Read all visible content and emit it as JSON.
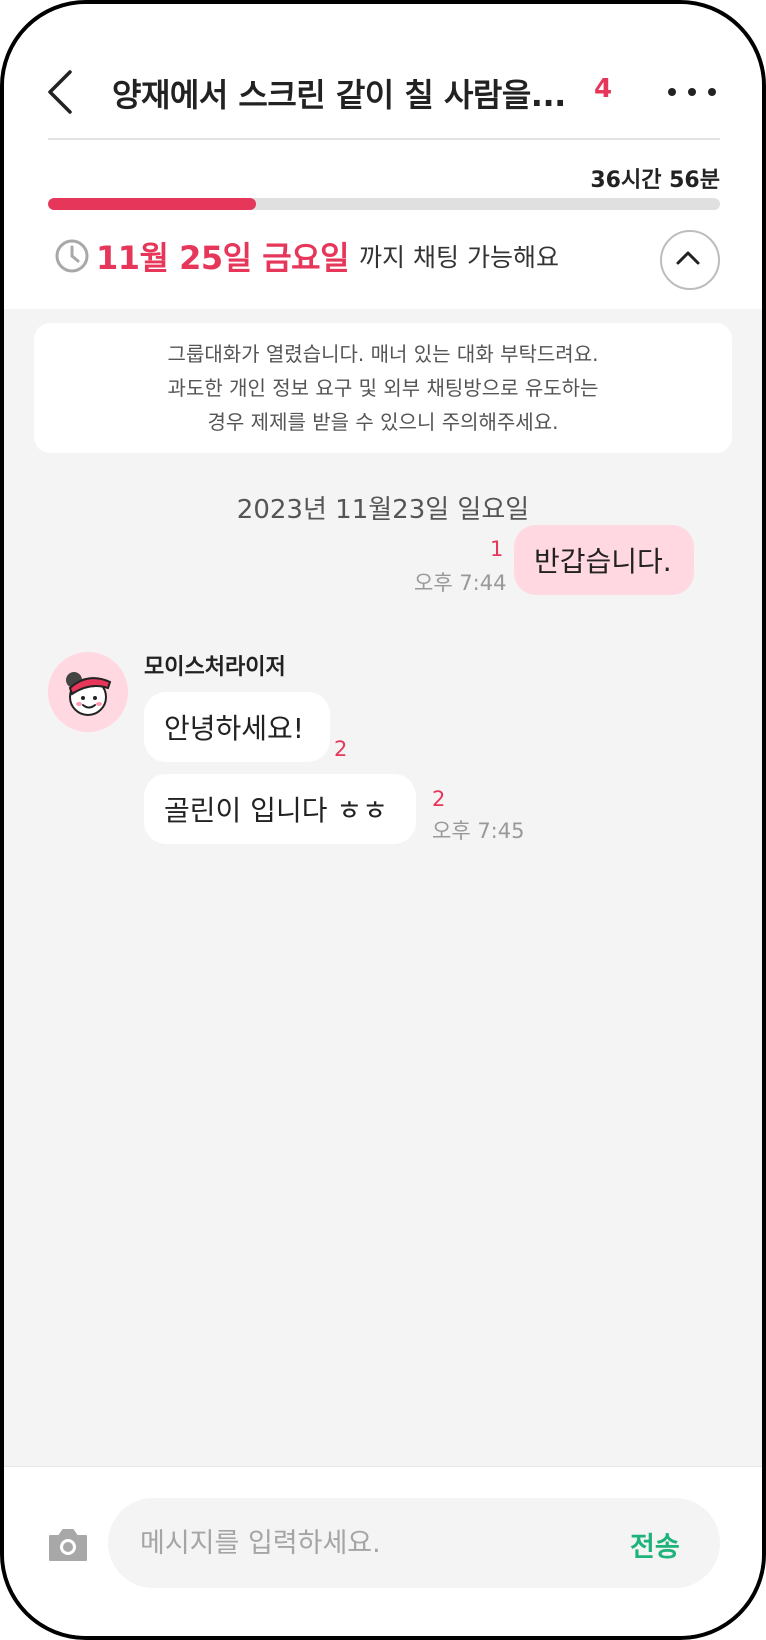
{
  "header": {
    "title": "양재에서 스크린 같이 칠 사람을...",
    "member_count": "4",
    "time_left": "36시간 56분",
    "progress_fraction": 0.31,
    "deadline_date": "11월 25일 금요일",
    "deadline_suffix": "까지 채팅 가능해요"
  },
  "notice": {
    "lines": [
      "그룹대화가 열렸습니다. 매너 있는 대화 부탁드려요.",
      "과도한 개인 정보 요구 및 외부 채팅방으로 유도하는",
      "경우 제제를 받을 수 있으니 주의해주세요."
    ]
  },
  "date_separator": "2023년 11월23일 일요일",
  "messages": [
    {
      "text": "반갑습니다.",
      "unread": "1",
      "time": "오후 7:44"
    },
    {
      "sender": "모이스처라이저",
      "text": "안녕하세요!",
      "unread": "2"
    },
    {
      "text": "골린이 입니다 ㅎㅎ",
      "unread": "2",
      "time": "오후 7:45"
    }
  ],
  "input": {
    "placeholder": "메시지를 입력하세요.",
    "send_label": "전송"
  },
  "colors": {
    "accent": "#e6365a",
    "send": "#1db37a",
    "my_bubble": "#ffd8e1",
    "chat_bg": "#f4f4f4"
  },
  "icons": [
    "back-arrow-icon",
    "more-icon",
    "clock-icon",
    "chevron-up-icon",
    "camera-icon"
  ]
}
